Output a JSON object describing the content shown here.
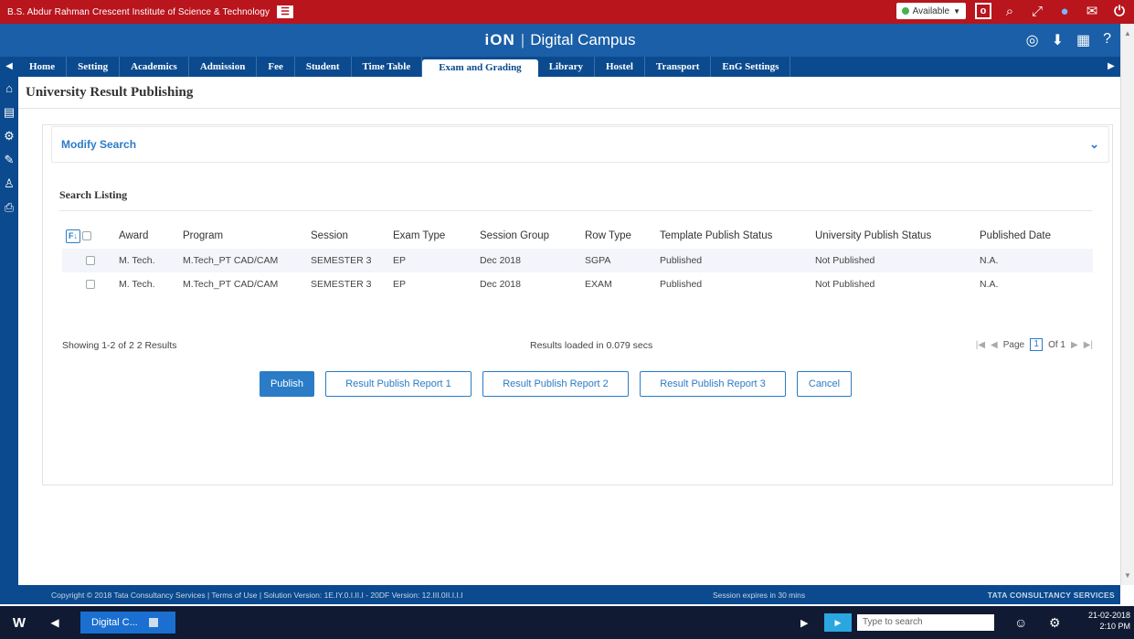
{
  "window": {
    "institution": "B.S. Abdur Rahman Crescent Institute of Science & Technology",
    "availability": "Available"
  },
  "header": {
    "brand": "iON",
    "product": "Digital Campus"
  },
  "menu": {
    "tabs": [
      "Home",
      "Setting",
      "Academics",
      "Admission",
      "Fee",
      "Student",
      "Time Table",
      "Exam and Grading",
      "Library",
      "Hostel",
      "Transport",
      "EnG Settings"
    ],
    "active": "Exam and Grading"
  },
  "page": {
    "title": "University Result Publishing",
    "modify_search": "Modify Search",
    "listing_title": "Search Listing"
  },
  "table": {
    "columns": [
      "Award",
      "Program",
      "Session",
      "Exam Type",
      "Session Group",
      "Row Type",
      "Template Publish Status",
      "University Publish Status",
      "Published Date"
    ],
    "rows": [
      {
        "award": "M. Tech.",
        "program": "M.Tech_PT CAD/CAM",
        "session": "SEMESTER 3",
        "exam_type": "EP",
        "session_group": "Dec 2018",
        "row_type": "SGPA",
        "template_status": "Published",
        "university_status": "Not Published",
        "published_date": "N.A."
      },
      {
        "award": "M. Tech.",
        "program": "M.Tech_PT CAD/CAM",
        "session": "SEMESTER 3",
        "exam_type": "EP",
        "session_group": "Dec 2018",
        "row_type": "EXAM",
        "template_status": "Published",
        "university_status": "Not Published",
        "published_date": "N.A."
      }
    ]
  },
  "footer": {
    "showing": "Showing 1-2 of 2 2 Results",
    "loaded": "Results loaded in 0.079 secs",
    "page_label": "Page",
    "page_value": "1",
    "of_label": "Of 1"
  },
  "buttons": {
    "publish": "Publish",
    "report1": "Result Publish Report 1",
    "report2": "Result Publish Report 2",
    "report3": "Result Publish Report 3",
    "cancel": "Cancel"
  },
  "status": {
    "copyright": "Copyright © 2018 Tata Consultancy Services | Terms of Use | Solution Version: 1E.IY.0.I.II.I - 20DF Version: 12.III.0II.I.I.I",
    "session": "Session expires in 30 mins",
    "company": "TATA CONSULTANCY SERVICES"
  },
  "taskbar": {
    "task": "Digital C...",
    "search": "Type to search",
    "clock_date": "21-02-2018",
    "clock_time": "2:10 PM"
  },
  "colors": {
    "top_red": "#b8151d",
    "header_blue": "#1a5fa8",
    "menu_blue": "#0b4a8e",
    "accent": "#2a7cc7"
  }
}
